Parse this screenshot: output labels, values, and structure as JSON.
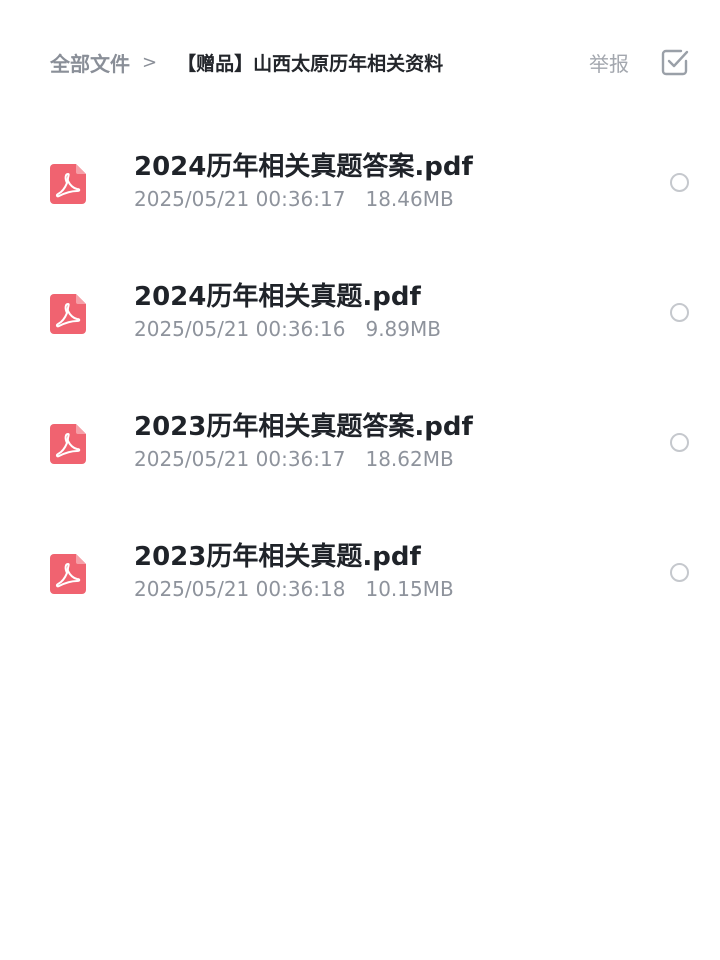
{
  "header": {
    "breadcrumb_root": "全部文件",
    "breadcrumb_separator": ">",
    "breadcrumb_current": "【赠品】山西太原历年相关资料",
    "report_label": "举报",
    "select_icon": "checkbox-icon"
  },
  "colors": {
    "pdf_icon": "#f06370",
    "title_text": "#1f2329",
    "meta_text": "#8e939c"
  },
  "files": [
    {
      "name": "2024历年相关真题答案.pdf",
      "date": "2025/05/21 00:36:17",
      "size": "18.46MB",
      "icon": "pdf-icon"
    },
    {
      "name": "2024历年相关真题.pdf",
      "date": "2025/05/21 00:36:16",
      "size": "9.89MB",
      "icon": "pdf-icon"
    },
    {
      "name": "2023历年相关真题答案.pdf",
      "date": "2025/05/21 00:36:17",
      "size": "18.62MB",
      "icon": "pdf-icon"
    },
    {
      "name": "2023历年相关真题.pdf",
      "date": "2025/05/21 00:36:18",
      "size": "10.15MB",
      "icon": "pdf-icon"
    }
  ]
}
